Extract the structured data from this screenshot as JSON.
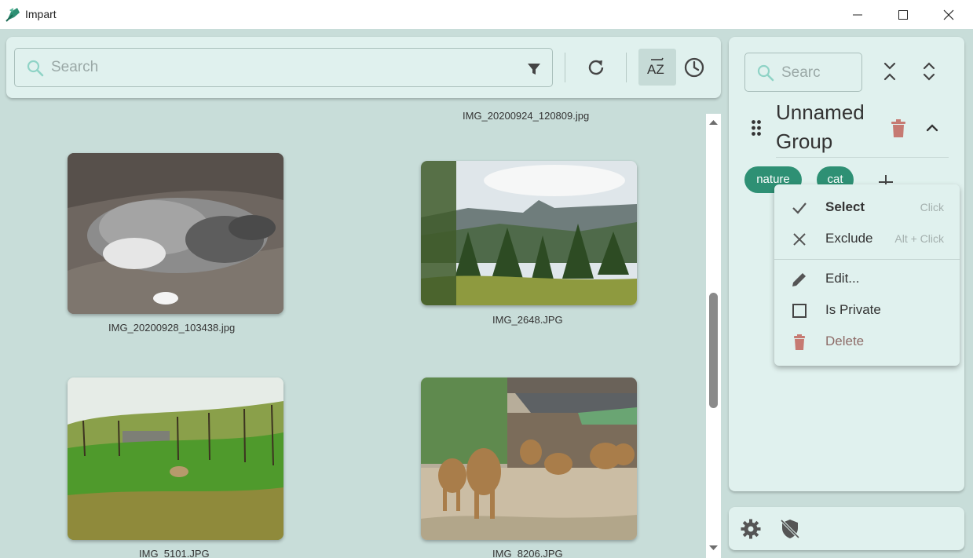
{
  "app": {
    "title": "Impart"
  },
  "search": {
    "placeholder": "Search"
  },
  "toolbar": {
    "sort_label": "AZ"
  },
  "gallery": {
    "items": [
      {
        "filename": "IMG_20200924_120809.jpg"
      },
      {
        "filename": "IMG_20200928_103438.jpg"
      },
      {
        "filename": "IMG_2648.JPG"
      },
      {
        "filename": "IMG_5101.JPG"
      },
      {
        "filename": "IMG_8206.JPG"
      }
    ]
  },
  "scroll": {
    "position": 0.55
  },
  "tag_panel": {
    "search_placeholder": "Searc",
    "group": {
      "name": "Unnamed Group"
    },
    "tags": [
      {
        "label": "nature"
      },
      {
        "label": "cat"
      }
    ]
  },
  "context_menu": {
    "items": [
      {
        "label": "Select",
        "shortcut": "Click",
        "icon": "check-icon"
      },
      {
        "label": "Exclude",
        "shortcut": "Alt + Click",
        "icon": "close-icon"
      },
      {
        "label": "Edit...",
        "icon": "pencil-icon"
      },
      {
        "label": "Is Private",
        "icon": "checkbox-icon"
      },
      {
        "label": "Delete",
        "icon": "trash-icon"
      }
    ]
  },
  "colors": {
    "background": "#c8ddd9",
    "panel": "#e0f1ee",
    "tag_chip": "#2e9074",
    "delete": "#c67a72"
  }
}
